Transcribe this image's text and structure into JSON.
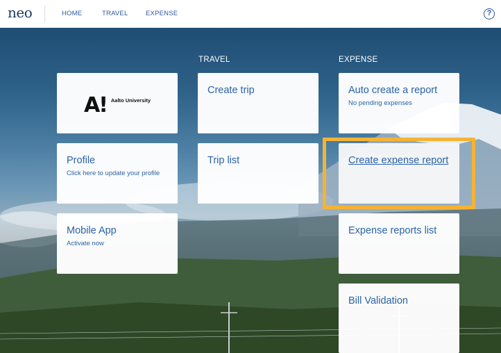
{
  "app": {
    "logo_text": "neo",
    "help_glyph": "?",
    "help_icon": "help-circle-icon"
  },
  "nav": {
    "items": [
      {
        "label": "HOME"
      },
      {
        "label": "TRAVEL"
      },
      {
        "label": "EXPENSE"
      }
    ]
  },
  "columns": {
    "travel_heading": "TRAVEL",
    "expense_heading": "EXPENSE"
  },
  "tiles": {
    "aalto": {
      "logo_mark": "A!",
      "logo_text": "Aalto University"
    },
    "profile": {
      "title": "Profile",
      "subtitle": "Click here to update your profile"
    },
    "mobile": {
      "title": "Mobile App",
      "subtitle": "Activate now"
    },
    "create_trip": {
      "title": "Create trip"
    },
    "trip_list": {
      "title": "Trip list"
    },
    "auto_report": {
      "title": "Auto create a report",
      "subtitle": "No pending expenses"
    },
    "create_expense": {
      "title": "Create expense report"
    },
    "expense_list": {
      "title": "Expense reports list"
    },
    "bill_validation": {
      "title": "Bill Validation"
    }
  },
  "colors": {
    "brand_text": "#1d3a62",
    "link": "#2b63a6",
    "highlight": "#f5b335"
  }
}
